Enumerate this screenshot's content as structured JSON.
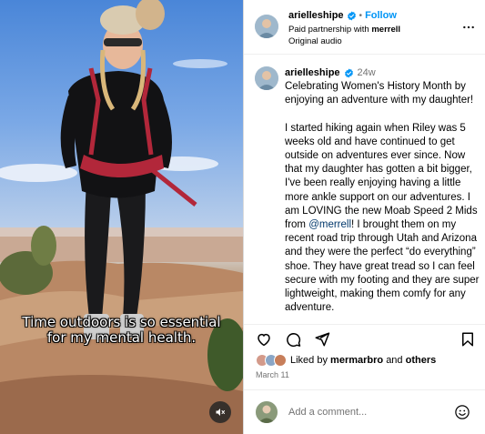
{
  "video": {
    "caption": "Time outdoors is so essential for my mental health."
  },
  "post": {
    "author": "arielleshipe",
    "follow_label": "Follow",
    "dot": "•",
    "partnership_prefix": "Paid partnership with",
    "partner": "merrell",
    "audio": "Original audio"
  },
  "caption_comment": {
    "author": "arielleshipe",
    "age": "24w",
    "paragraph1": "Celebrating Women's History Month by enjoying an adventure with my daughter!",
    "paragraph2_a": "I started hiking again when Riley was 5 weeks old and have continued to get outside on adventures ever since. Now that my daughter has gotten a bit bigger, I've been really enjoying having a little more ankle support on our adventures. I am LOVING the new Moab Speed 2 Mids from ",
    "mention": "@merrell",
    "paragraph2_b": "! I brought them on my recent road trip through Utah and Arizona and they were the perfect “do everything” shoe. They have great tread so I can feel secure with my footing and they are super lightweight, making them comfy for any adventure."
  },
  "likes": {
    "prefix": "Liked by",
    "user": "mermarbro",
    "conjunction": "and",
    "others": "others"
  },
  "date": "March 11",
  "composer": {
    "placeholder": "Add a comment..."
  },
  "colors": {
    "link_blue": "#0095f6",
    "verified_blue": "#0095f6",
    "muted_text": "#737373",
    "divider": "#dbdbdb"
  }
}
